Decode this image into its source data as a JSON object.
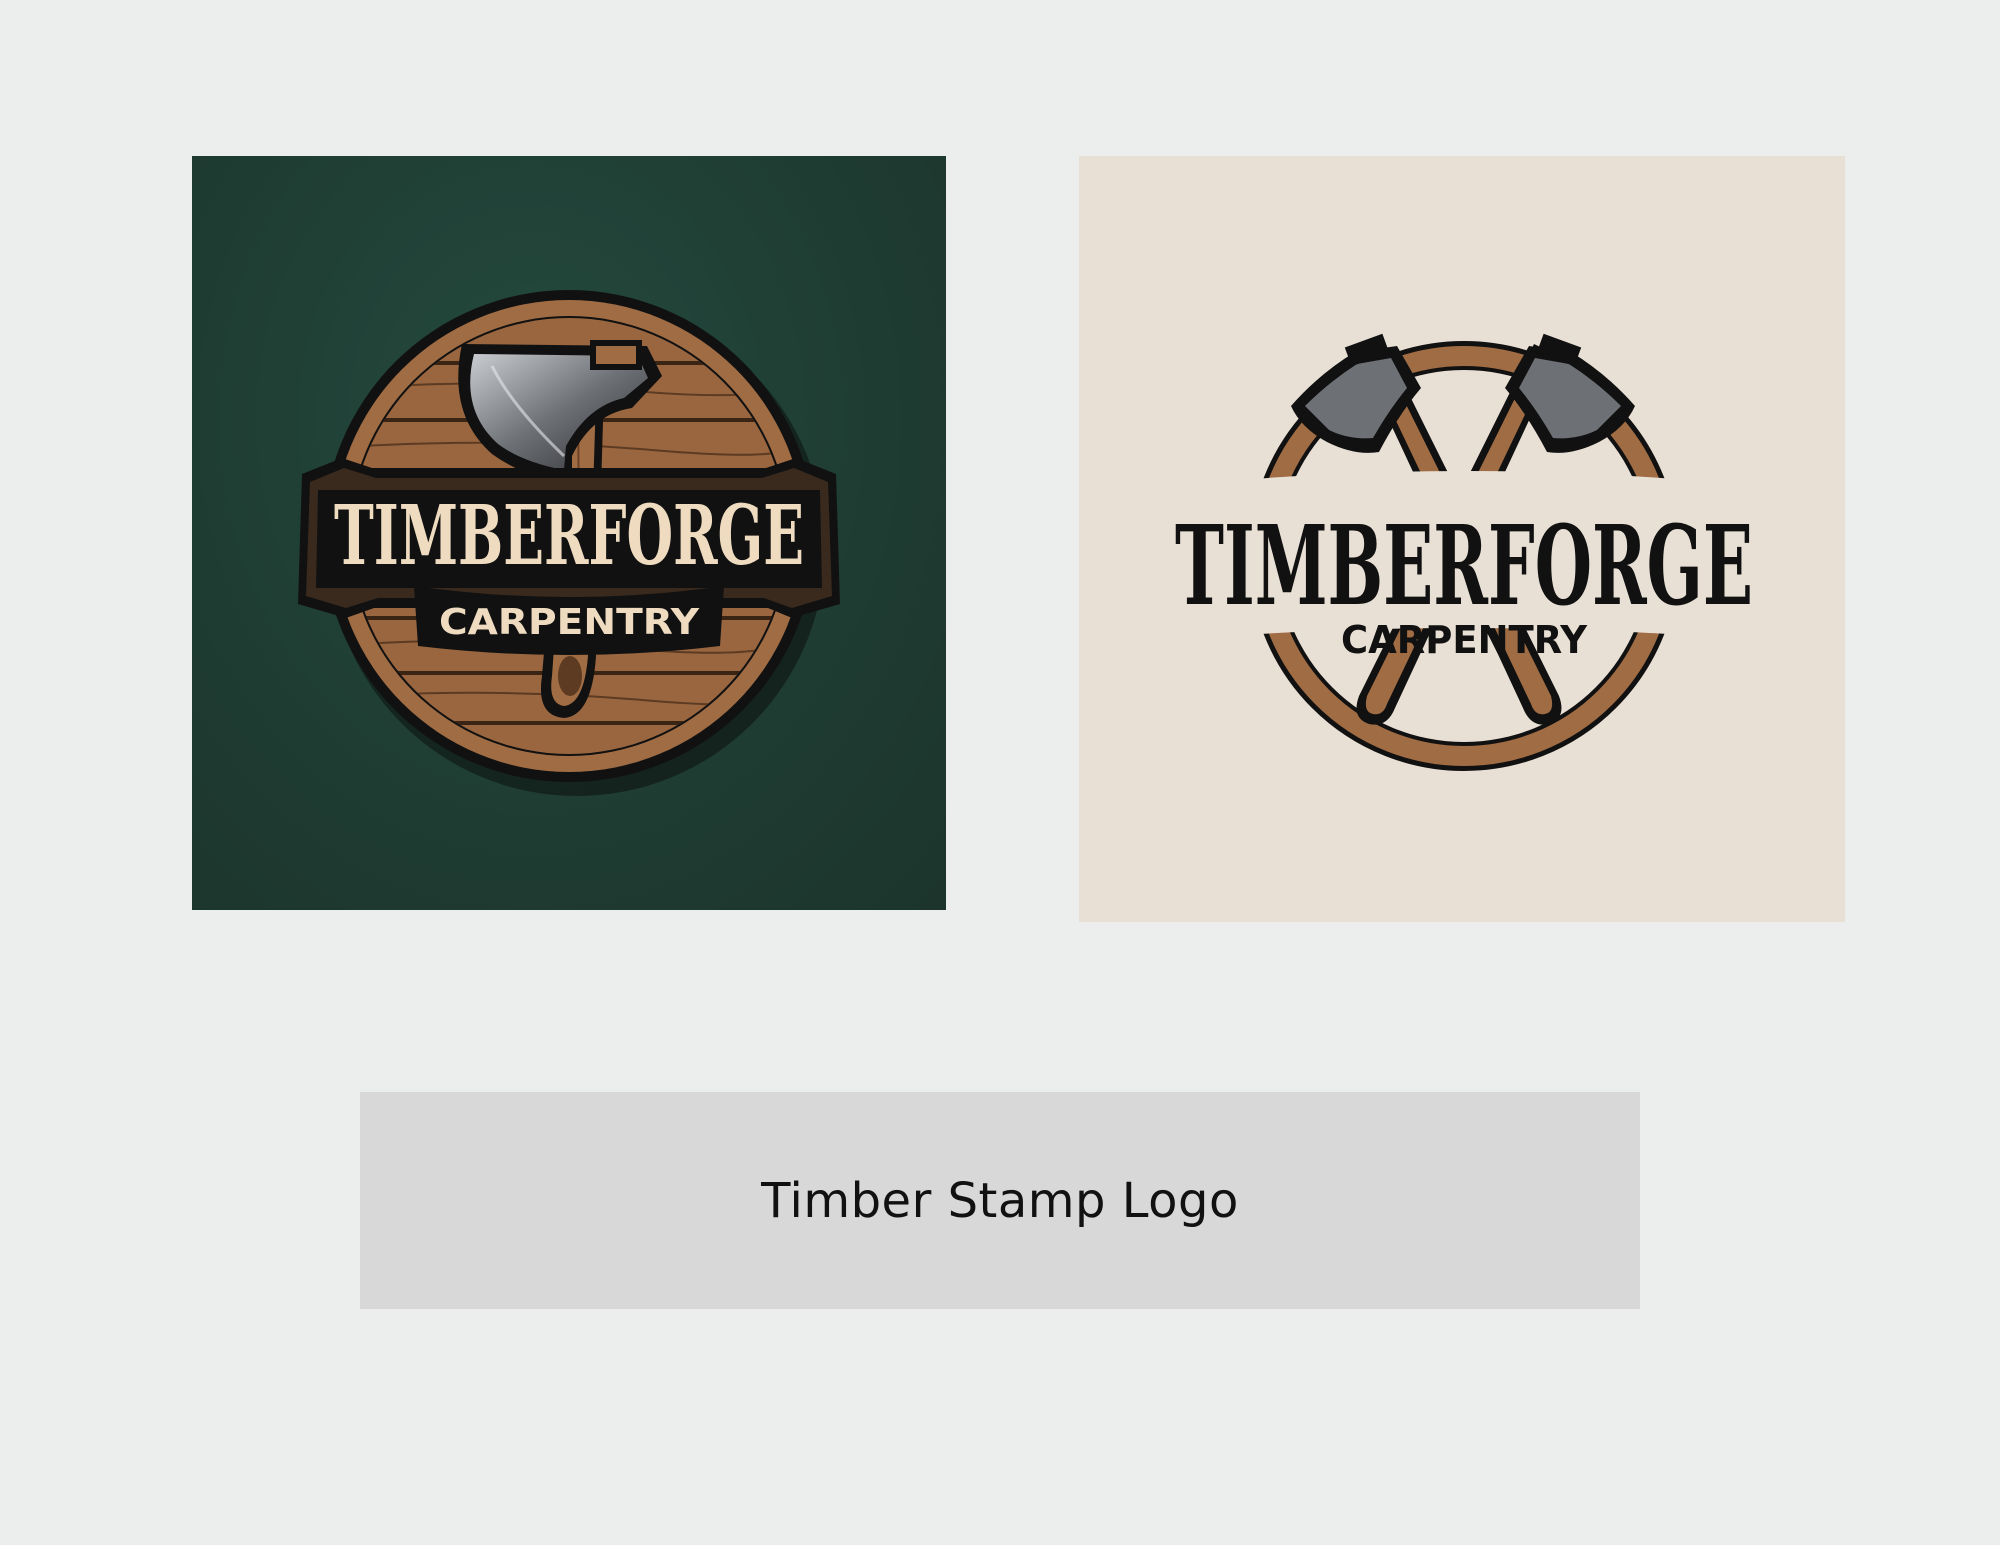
{
  "logos": [
    {
      "variant": "dark-green-background",
      "title": "TIMBERFORGE",
      "subtitle": "CARPENTRY",
      "icon": "axe-icon",
      "colors": {
        "background": "#1f3d33",
        "wood": "#a06c44",
        "ink": "#111111",
        "cream": "#efdcc0",
        "steel": "#8a8d92"
      }
    },
    {
      "variant": "cream-background",
      "title": "TIMBERFORGE",
      "subtitle": "CARPENTRY",
      "icon": "crossed-axes-icon",
      "colors": {
        "background": "#e8e0d5",
        "wood": "#a06c44",
        "ink": "#111111"
      }
    }
  ],
  "caption": "Timber Stamp Logo"
}
